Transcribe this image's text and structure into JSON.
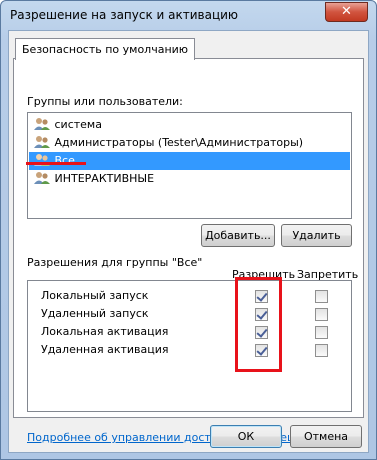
{
  "window": {
    "title": "Разрешение на запуск и активацию",
    "close_glyph": "✕"
  },
  "tab": {
    "label": "Безопасность по умолчанию"
  },
  "groups": {
    "label": "Группы или пользователи:",
    "items": [
      {
        "name": "система",
        "selected": false
      },
      {
        "name": "Администраторы (Tester\\Администраторы)",
        "selected": false
      },
      {
        "name": "Все",
        "selected": true
      },
      {
        "name": "ИНТЕРАКТИВНЫЕ",
        "selected": false
      }
    ]
  },
  "buttons": {
    "add": "Добавить...",
    "remove": "Удалить",
    "ok": "ОК",
    "cancel": "Отмена"
  },
  "permissions": {
    "label": "Разрешения для группы \"Все\"",
    "allow_header": "Разрешить",
    "deny_header": "Запретить",
    "rows": [
      {
        "name": "Локальный запуск",
        "allow": true,
        "deny": false
      },
      {
        "name": "Удаленный запуск",
        "allow": true,
        "deny": false
      },
      {
        "name": "Локальная активация",
        "allow": true,
        "deny": false
      },
      {
        "name": "Удаленная активация",
        "allow": true,
        "deny": false
      }
    ]
  },
  "help_link": "Подробнее об управлении доступом и разрешениях",
  "colors": {
    "selection": "#3399ff",
    "annotation_red": "#e8121a",
    "link": "#0066cc"
  }
}
